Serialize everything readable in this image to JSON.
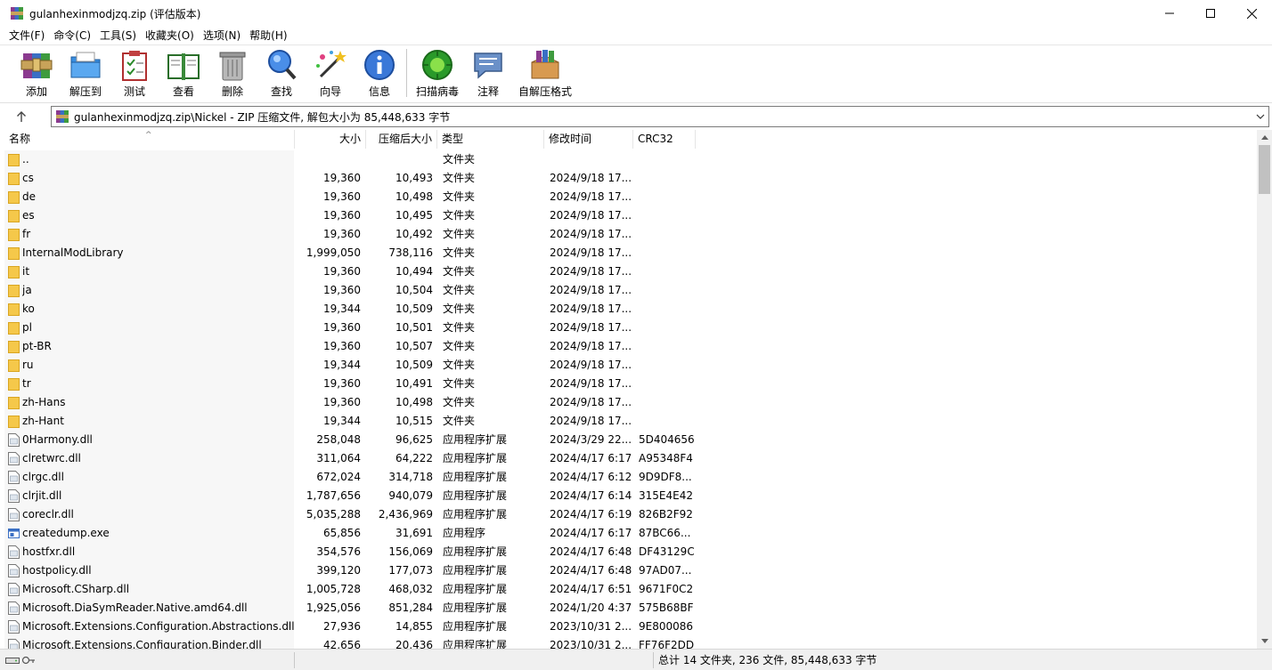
{
  "window": {
    "title": "gulanhexinmodjzq.zip (评估版本)",
    "controls": [
      "minimize",
      "maximize",
      "close"
    ]
  },
  "menu": [
    "文件(F)",
    "命令(C)",
    "工具(S)",
    "收藏夹(O)",
    "选项(N)",
    "帮助(H)"
  ],
  "toolbar": [
    {
      "label": "添加",
      "icon": "add-archive-icon"
    },
    {
      "label": "解压到",
      "icon": "extract-to-icon"
    },
    {
      "label": "测试",
      "icon": "test-icon"
    },
    {
      "label": "查看",
      "icon": "view-icon"
    },
    {
      "label": "删除",
      "icon": "delete-icon"
    },
    {
      "label": "查找",
      "icon": "find-icon"
    },
    {
      "label": "向导",
      "icon": "wizard-icon"
    },
    {
      "label": "信息",
      "icon": "info-icon"
    },
    {
      "label": "扫描病毒",
      "icon": "virus-scan-icon"
    },
    {
      "label": "注释",
      "icon": "comment-icon"
    },
    {
      "label": "自解压格式",
      "icon": "sfx-icon"
    }
  ],
  "address": {
    "path": "gulanhexinmodjzq.zip\\Nickel - ZIP 压缩文件, 解包大小为 85,448,633 字节"
  },
  "columns": {
    "name": "名称",
    "size": "大小",
    "packed": "压缩后大小",
    "type": "类型",
    "modified": "修改时间",
    "crc": "CRC32"
  },
  "files": [
    {
      "name": "..",
      "size": "",
      "packed": "",
      "type": "文件夹",
      "modified": "",
      "crc": "",
      "icon": "folder"
    },
    {
      "name": "cs",
      "size": "19,360",
      "packed": "10,493",
      "type": "文件夹",
      "modified": "2024/9/18 17...",
      "crc": "",
      "icon": "folder"
    },
    {
      "name": "de",
      "size": "19,360",
      "packed": "10,498",
      "type": "文件夹",
      "modified": "2024/9/18 17...",
      "crc": "",
      "icon": "folder"
    },
    {
      "name": "es",
      "size": "19,360",
      "packed": "10,495",
      "type": "文件夹",
      "modified": "2024/9/18 17...",
      "crc": "",
      "icon": "folder"
    },
    {
      "name": "fr",
      "size": "19,360",
      "packed": "10,492",
      "type": "文件夹",
      "modified": "2024/9/18 17...",
      "crc": "",
      "icon": "folder"
    },
    {
      "name": "InternalModLibrary",
      "size": "1,999,050",
      "packed": "738,116",
      "type": "文件夹",
      "modified": "2024/9/18 17...",
      "crc": "",
      "icon": "folder"
    },
    {
      "name": "it",
      "size": "19,360",
      "packed": "10,494",
      "type": "文件夹",
      "modified": "2024/9/18 17...",
      "crc": "",
      "icon": "folder"
    },
    {
      "name": "ja",
      "size": "19,360",
      "packed": "10,504",
      "type": "文件夹",
      "modified": "2024/9/18 17...",
      "crc": "",
      "icon": "folder"
    },
    {
      "name": "ko",
      "size": "19,344",
      "packed": "10,509",
      "type": "文件夹",
      "modified": "2024/9/18 17...",
      "crc": "",
      "icon": "folder"
    },
    {
      "name": "pl",
      "size": "19,360",
      "packed": "10,501",
      "type": "文件夹",
      "modified": "2024/9/18 17...",
      "crc": "",
      "icon": "folder"
    },
    {
      "name": "pt-BR",
      "size": "19,360",
      "packed": "10,507",
      "type": "文件夹",
      "modified": "2024/9/18 17...",
      "crc": "",
      "icon": "folder"
    },
    {
      "name": "ru",
      "size": "19,344",
      "packed": "10,509",
      "type": "文件夹",
      "modified": "2024/9/18 17...",
      "crc": "",
      "icon": "folder"
    },
    {
      "name": "tr",
      "size": "19,360",
      "packed": "10,491",
      "type": "文件夹",
      "modified": "2024/9/18 17...",
      "crc": "",
      "icon": "folder"
    },
    {
      "name": "zh-Hans",
      "size": "19,360",
      "packed": "10,498",
      "type": "文件夹",
      "modified": "2024/9/18 17...",
      "crc": "",
      "icon": "folder"
    },
    {
      "name": "zh-Hant",
      "size": "19,344",
      "packed": "10,515",
      "type": "文件夹",
      "modified": "2024/9/18 17...",
      "crc": "",
      "icon": "folder"
    },
    {
      "name": "0Harmony.dll",
      "size": "258,048",
      "packed": "96,625",
      "type": "应用程序扩展",
      "modified": "2024/3/29 22...",
      "crc": "5D404656",
      "icon": "dll"
    },
    {
      "name": "clretwrc.dll",
      "size": "311,064",
      "packed": "64,222",
      "type": "应用程序扩展",
      "modified": "2024/4/17 6:17",
      "crc": "A95348F4",
      "icon": "dll"
    },
    {
      "name": "clrgc.dll",
      "size": "672,024",
      "packed": "314,718",
      "type": "应用程序扩展",
      "modified": "2024/4/17 6:12",
      "crc": "9D9DF8...",
      "icon": "dll"
    },
    {
      "name": "clrjit.dll",
      "size": "1,787,656",
      "packed": "940,079",
      "type": "应用程序扩展",
      "modified": "2024/4/17 6:14",
      "crc": "315E4E42",
      "icon": "dll"
    },
    {
      "name": "coreclr.dll",
      "size": "5,035,288",
      "packed": "2,436,969",
      "type": "应用程序扩展",
      "modified": "2024/4/17 6:19",
      "crc": "826B2F92",
      "icon": "dll"
    },
    {
      "name": "createdump.exe",
      "size": "65,856",
      "packed": "31,691",
      "type": "应用程序",
      "modified": "2024/4/17 6:17",
      "crc": "87BC66...",
      "icon": "exe"
    },
    {
      "name": "hostfxr.dll",
      "size": "354,576",
      "packed": "156,069",
      "type": "应用程序扩展",
      "modified": "2024/4/17 6:48",
      "crc": "DF43129C",
      "icon": "dll"
    },
    {
      "name": "hostpolicy.dll",
      "size": "399,120",
      "packed": "177,073",
      "type": "应用程序扩展",
      "modified": "2024/4/17 6:48",
      "crc": "97AD07...",
      "icon": "dll"
    },
    {
      "name": "Microsoft.CSharp.dll",
      "size": "1,005,728",
      "packed": "468,032",
      "type": "应用程序扩展",
      "modified": "2024/4/17 6:51",
      "crc": "9671F0C2",
      "icon": "dll"
    },
    {
      "name": "Microsoft.DiaSymReader.Native.amd64.dll",
      "size": "1,925,056",
      "packed": "851,284",
      "type": "应用程序扩展",
      "modified": "2024/1/20 4:37",
      "crc": "575B68BF",
      "icon": "dll"
    },
    {
      "name": "Microsoft.Extensions.Configuration.Abstractions.dll",
      "size": "27,936",
      "packed": "14,855",
      "type": "应用程序扩展",
      "modified": "2023/10/31 2...",
      "crc": "9E800086",
      "icon": "dll"
    },
    {
      "name": "Microsoft.Extensions.Configuration.Binder.dll",
      "size": "42,656",
      "packed": "20,436",
      "type": "应用程序扩展",
      "modified": "2023/10/31 2...",
      "crc": "FF76F2DD",
      "icon": "dll"
    }
  ],
  "status": {
    "summary": "总计 14 文件夹, 236 文件, 85,448,633 字节"
  }
}
